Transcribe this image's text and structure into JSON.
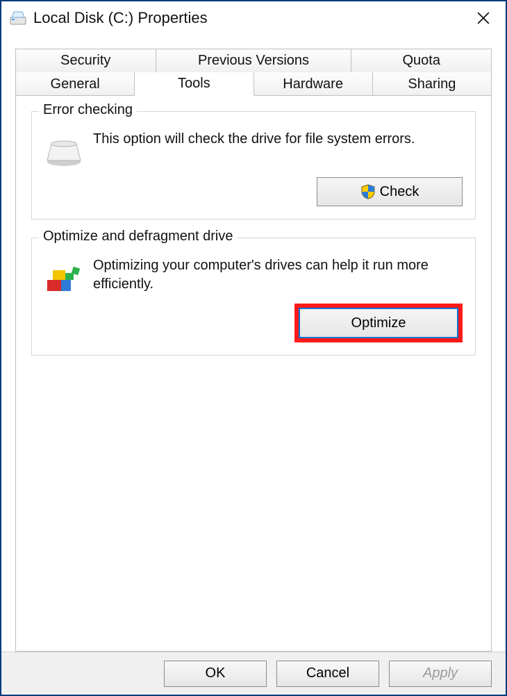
{
  "window": {
    "title": "Local Disk (C:) Properties"
  },
  "tabs": {
    "row1": [
      "Security",
      "Previous Versions",
      "Quota"
    ],
    "row2": [
      "General",
      "Tools",
      "Hardware",
      "Sharing"
    ],
    "active": "Tools"
  },
  "error_checking": {
    "title": "Error checking",
    "text": "This option will check the drive for file system errors.",
    "button": "Check"
  },
  "optimize": {
    "title": "Optimize and defragment drive",
    "text": "Optimizing your computer's drives can help it run more efficiently.",
    "button": "Optimize"
  },
  "buttons": {
    "ok": "OK",
    "cancel": "Cancel",
    "apply": "Apply"
  }
}
